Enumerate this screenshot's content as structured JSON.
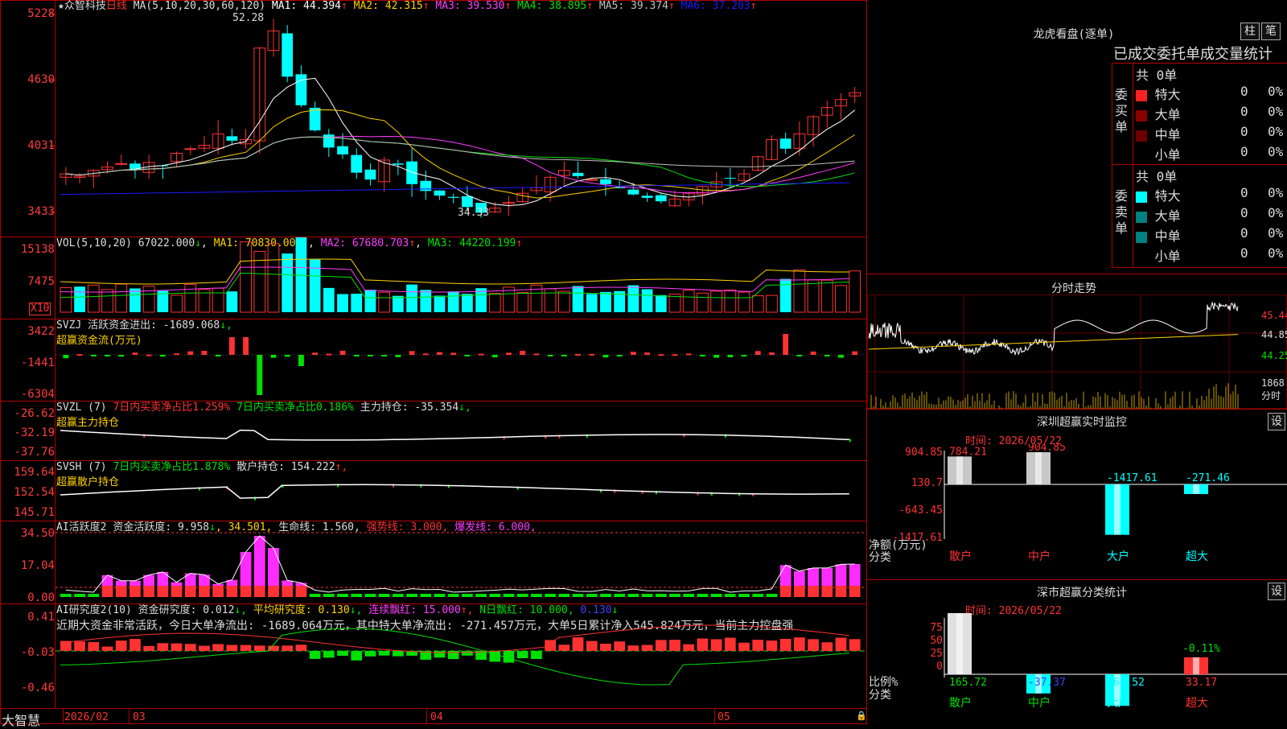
{
  "stock": {
    "star": "★",
    "name": "众智科技",
    "period": "日线"
  },
  "colors": {
    "up": "#ff3232",
    "down": "#00ffff",
    "ma1": "#ffffff",
    "ma2": "#ffd200",
    "ma3": "#ff3cff",
    "ma4": "#00e000",
    "ma5": "#c0c0c0",
    "ma6": "#1a1aff",
    "grid": "#b00000"
  },
  "main": {
    "ma_label": "MA(5,10,20,30,60,120)",
    "ma": [
      {
        "name": "MA1:",
        "value": "44.394",
        "arrow": "↑"
      },
      {
        "name": "MA2:",
        "value": "42.315",
        "arrow": "↑"
      },
      {
        "name": "MA3:",
        "value": "39.530",
        "arrow": "↑"
      },
      {
        "name": "MA4:",
        "value": "38.895",
        "arrow": "↑"
      },
      {
        "name": "MA5:",
        "value": "39.374",
        "arrow": "↑"
      },
      {
        "name": "MA6:",
        "value": "37.203",
        "arrow": "↑"
      }
    ],
    "yticks": [
      "5228",
      "4630",
      "4031",
      "3433"
    ],
    "high_label": "52.28",
    "low_label": "34.33"
  },
  "vol": {
    "label": "VOL(5,10,20)",
    "value": "67022.000",
    "arrow": "↓",
    "ma1": "MA1: 70830.000",
    "ma1_arrow": "↑",
    "ma2": "MA2: 67680.703",
    "ma2_arrow": "↑",
    "ma3": "MA3: 44220.199",
    "ma3_arrow": "↑",
    "yticks": [
      "15138",
      "7475"
    ],
    "unit": "X10"
  },
  "svzj": {
    "label": "SVZJ",
    "text": "活跃资金进出: -1689.068",
    "arrow": "↓,",
    "subtitle": "超赢资金流(万元)",
    "yticks": [
      "3422",
      "-1441",
      "-6304"
    ]
  },
  "svzl": {
    "label": "SVZL (7)",
    "t1": "7日内买卖净占比1.259%",
    "t2": "7日内买卖净占比0.186%",
    "t3": "主力持仓: -35.354",
    "arrow": "↓,",
    "subtitle": "超赢主力持仓",
    "yticks": [
      "-26.62",
      "-32.19",
      "-37.76"
    ]
  },
  "svsh": {
    "label": "SVSH (7)",
    "t1": "7日内买卖净占比1.878%",
    "t2": "散户持仓: 154.222",
    "arrow": "↑,",
    "subtitle": "超赢散户持仓",
    "yticks": [
      "159.64",
      "152.54",
      "145.71"
    ]
  },
  "ai1": {
    "label": "AI活跃度2",
    "t1": "资金活跃度: 9.958",
    "a1": "↓",
    "t2": "34.501,",
    "t3": "生命线: 1.560,",
    "t4": "强势线: 3.000,",
    "t5": "爆发线: 6.000,",
    "yticks": [
      "34.50",
      "17.04",
      "0.00"
    ]
  },
  "ai2": {
    "label": "AI研究度2(10)",
    "t1": "资金研究度: 0.012",
    "a1": "↓,",
    "t2": "平均研究度: 0.130",
    "a2": "↓,",
    "t3": "连续飘红: 15.000",
    "a3": "↑,",
    "t4": "N日飘红: 10.000,",
    "t5": "0.130",
    "a5": "↓",
    "summary": "近期大资金非常活跃，今日大单净流出: -1689.064万元，其中特大单净流出: -271.457万元，大单5日累计净入545.824万元，当前主力控盘强",
    "yticks": [
      "0.41",
      "-0.03",
      "-0.46"
    ]
  },
  "footer": {
    "brand": "大智慧",
    "dates": [
      "2026/02",
      "03",
      "04",
      "05"
    ]
  },
  "dragon": {
    "title": "龙虎看盘(逐单)",
    "btn1": "柱",
    "btn2": "笔",
    "tabs": [
      "已成交",
      "委托单",
      "成交量",
      "统计"
    ],
    "buy": {
      "side": "委买单",
      "total": "共 0单",
      "rows": [
        {
          "k": "特大",
          "v": "0",
          "p": "0%"
        },
        {
          "k": "大单",
          "v": "0",
          "p": "0%"
        },
        {
          "k": "中单",
          "v": "0",
          "p": "0%"
        },
        {
          "k": "小单",
          "v": "0",
          "p": "0%"
        }
      ]
    },
    "sell": {
      "side": "委卖单",
      "total": "共 0单",
      "rows": [
        {
          "k": "特大",
          "v": "0",
          "p": "0%"
        },
        {
          "k": "大单",
          "v": "0",
          "p": "0%"
        },
        {
          "k": "中单",
          "v": "0",
          "p": "0%"
        },
        {
          "k": "小单",
          "v": "0",
          "p": "0%"
        }
      ]
    }
  },
  "intraday": {
    "title": "分时走势",
    "yticks": [
      "45.44",
      "44.85",
      "44.25"
    ],
    "vol_top": "1868",
    "vol_unit": "分时"
  },
  "sz_monitor": {
    "title": "深圳超赢实时监控",
    "btn": "设",
    "time": "时间: 2026/05/22",
    "yticks": [
      "904.85",
      "130.7",
      "-643.45",
      "-1417.61"
    ],
    "ylabel": "净额(万元)",
    "xlabel": "分类",
    "chart_data": {
      "type": "bar",
      "categories": [
        "散户",
        "中户",
        "大户",
        "超大"
      ],
      "values": [
        784.21,
        904.85,
        -1417.61,
        -271.46
      ],
      "ylim": [
        -1417.61,
        904.85
      ]
    }
  },
  "sz_class": {
    "title": "深市超赢分类统计",
    "btn": "设",
    "time": "时间: 2026/05/22",
    "yticks": [
      "75",
      "50",
      "25",
      "0"
    ],
    "ylabel": "比例%",
    "xlabel": "分类",
    "extra": "-0.11%",
    "chart_data": {
      "type": "bar",
      "categories": [
        "散户",
        "中户",
        "大户",
        "超大"
      ],
      "values": [
        165.72,
        -37.37,
        -61.52,
        33.17
      ],
      "ylim": [
        0,
        100
      ]
    }
  }
}
